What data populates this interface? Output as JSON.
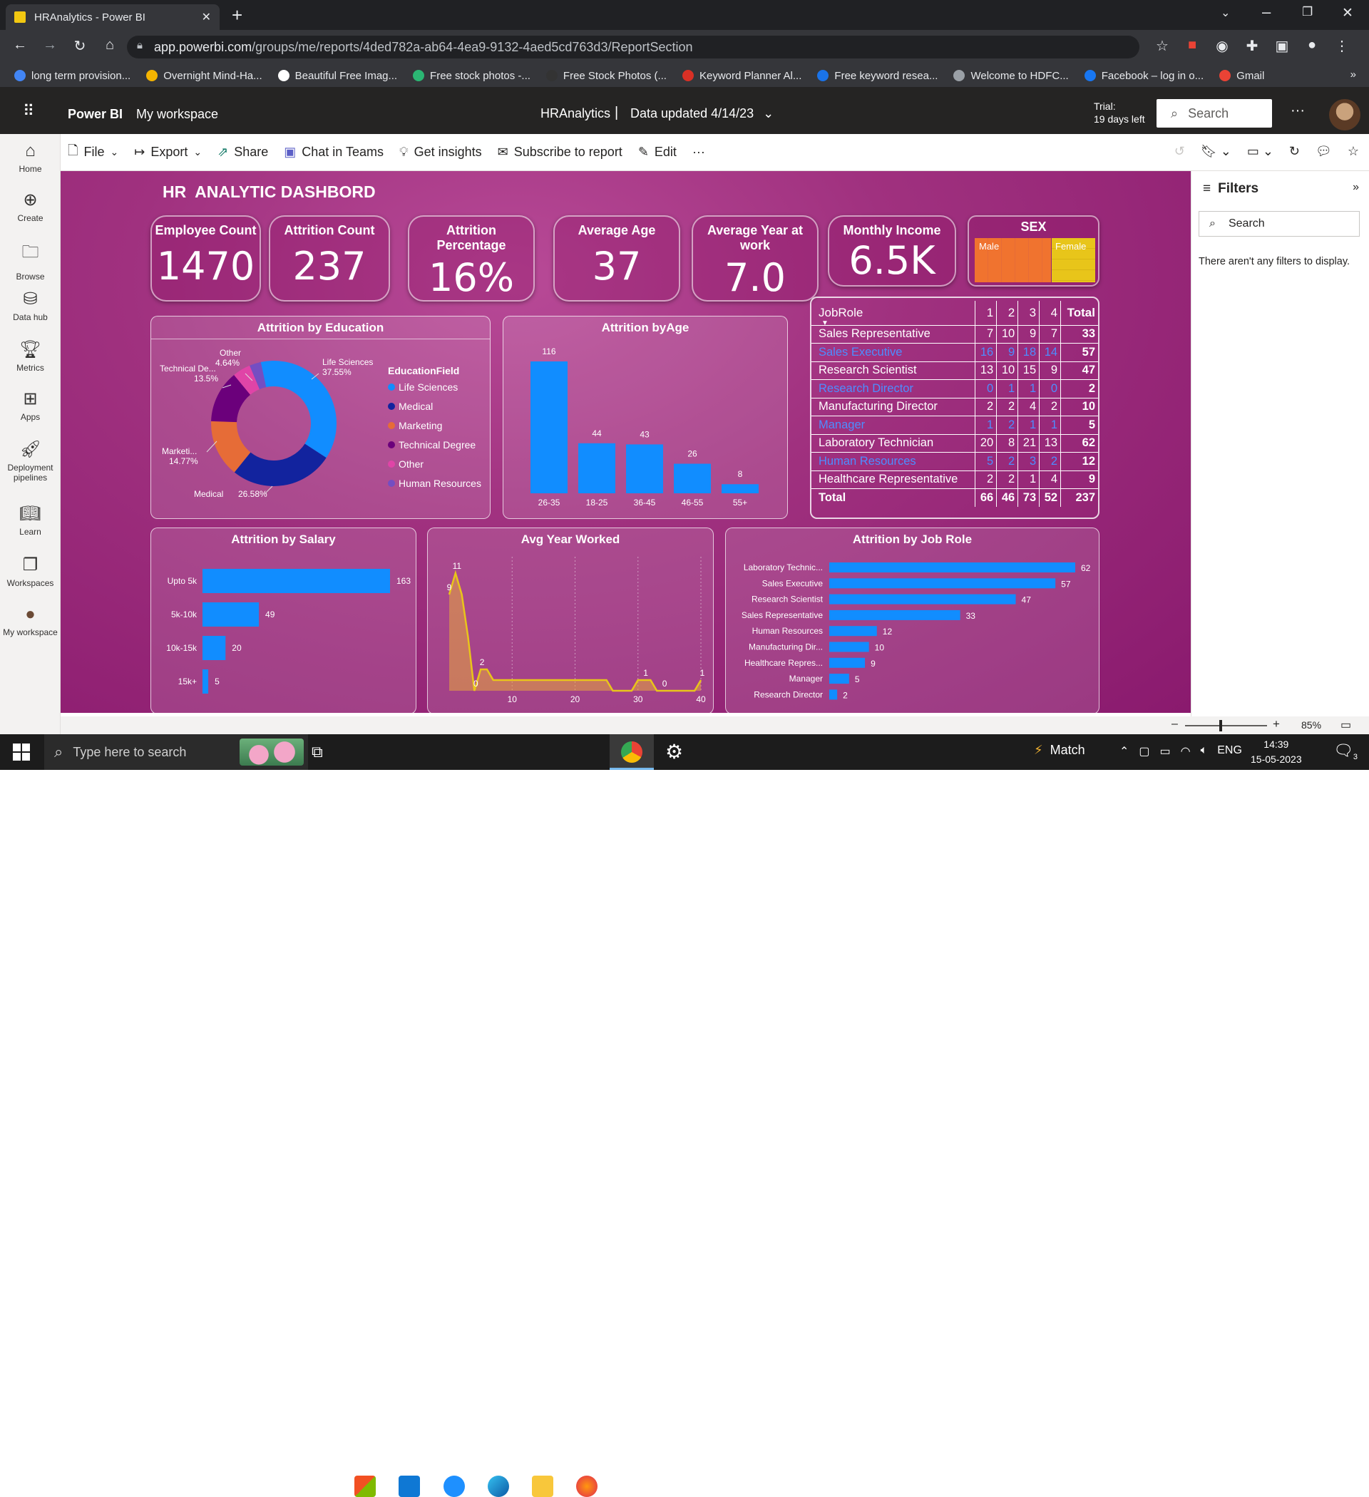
{
  "browser": {
    "tab_title": "HRAnalytics - Power BI",
    "url_host": "app.powerbi.com",
    "url_path": "/groups/me/reports/4ded782a-ab64-4ea9-9132-4aed5cd763d3/ReportSection",
    "bookmarks": [
      {
        "label": "long term provision...",
        "color": "#4285f4"
      },
      {
        "label": "Overnight Mind-Ha...",
        "color": "#f4b400"
      },
      {
        "label": "Beautiful Free Imag...",
        "color": "#ffffff"
      },
      {
        "label": "Free stock photos -...",
        "color": "#2bb673"
      },
      {
        "label": "Free Stock Photos (...",
        "color": "#333333"
      },
      {
        "label": "Keyword Planner Al...",
        "color": "#d93025"
      },
      {
        "label": "Free keyword resea...",
        "color": "#1a73e8"
      },
      {
        "label": "Welcome to HDFC...",
        "color": "#9aa0a6"
      },
      {
        "label": "Facebook – log in o...",
        "color": "#1877f2"
      },
      {
        "label": "Gmail",
        "color": "#ea4335"
      }
    ]
  },
  "pbi": {
    "app_name": "Power BI",
    "workspace": "My workspace",
    "report_name": "HRAnalytics",
    "data_updated": "Data updated 4/14/23",
    "trial_line1": "Trial:",
    "trial_line2": "19 days left",
    "search_placeholder": "Search",
    "commands": [
      "File",
      "Export",
      "Share",
      "Chat in Teams",
      "Get insights",
      "Subscribe to report",
      "Edit"
    ],
    "nav": [
      {
        "label": "Home",
        "icon": "home-icon"
      },
      {
        "label": "Create",
        "icon": "plus-circle-icon"
      },
      {
        "label": "Browse",
        "icon": "folder-icon"
      },
      {
        "label": "Data hub",
        "icon": "database-icon"
      },
      {
        "label": "Metrics",
        "icon": "trophy-icon"
      },
      {
        "label": "Apps",
        "icon": "apps-icon"
      },
      {
        "label": "Deployment pipelines",
        "icon": "rocket-icon"
      },
      {
        "label": "Learn",
        "icon": "book-icon"
      },
      {
        "label": "Workspaces",
        "icon": "workspaces-icon"
      },
      {
        "label": "My workspace",
        "icon": "avatar-icon"
      }
    ],
    "filters_title": "Filters",
    "filters_search": "Search",
    "filters_empty": "There aren't any filters to display.",
    "zoom": "85%"
  },
  "dashboard": {
    "title": "HR  ANALYTIC DASHBORD",
    "kpis": [
      {
        "label": "Employee Count",
        "value": "1470"
      },
      {
        "label": "Attrition Count",
        "value": "237"
      },
      {
        "label": "Attrition Percentage",
        "value": "16%"
      },
      {
        "label": "Average Age",
        "value": "37"
      },
      {
        "label": "Average Year at work",
        "value": "7.0"
      },
      {
        "label": "Monthly Income",
        "value": "6.5K"
      }
    ],
    "sex": {
      "title": "SEX",
      "male": "Male",
      "female": "Female"
    }
  },
  "chart_data": [
    {
      "type": "pie",
      "title": "Attrition by Education",
      "legend_title": "EducationField",
      "slices": [
        {
          "name": "Life Sciences",
          "value": 37.55,
          "label": "37.55%",
          "color": "#118dff"
        },
        {
          "name": "Medical",
          "value": 26.58,
          "label": "26.58%",
          "color": "#12239e"
        },
        {
          "name": "Marketing",
          "value": 14.77,
          "label": "14.77%",
          "color": "#e66c37"
        },
        {
          "name": "Technical Degree",
          "value": 13.5,
          "label": "13.5%",
          "color": "#6b007b"
        },
        {
          "name": "Other",
          "value": 4.64,
          "label": "4.64%",
          "color": "#e044a7"
        },
        {
          "name": "Human Resources",
          "value": 2.96,
          "label": "",
          "color": "#744ec2"
        }
      ],
      "slice_labels": [
        "Life Sciences",
        "Medical",
        "Marketi...",
        "Technical De...",
        "Other"
      ]
    },
    {
      "type": "bar",
      "title": "Attrition byAge",
      "categories": [
        "26-35",
        "18-25",
        "36-45",
        "46-55",
        "55+"
      ],
      "values": [
        116,
        44,
        43,
        26,
        8
      ],
      "color": "#118dff"
    },
    {
      "type": "table",
      "title": "JobRole",
      "columns": [
        "JobRole",
        "1",
        "2",
        "3",
        "4",
        "Total"
      ],
      "rows": [
        [
          "Sales Representative",
          "7",
          "10",
          "9",
          "7",
          "33"
        ],
        [
          "Sales Executive",
          "16",
          "9",
          "18",
          "14",
          "57"
        ],
        [
          "Research Scientist",
          "13",
          "10",
          "15",
          "9",
          "47"
        ],
        [
          "Research Director",
          "0",
          "1",
          "1",
          "0",
          "2"
        ],
        [
          "Manufacturing Director",
          "2",
          "2",
          "4",
          "2",
          "10"
        ],
        [
          "Manager",
          "1",
          "2",
          "1",
          "1",
          "5"
        ],
        [
          "Laboratory Technician",
          "20",
          "8",
          "21",
          "13",
          "62"
        ],
        [
          "Human Resources",
          "5",
          "2",
          "3",
          "2",
          "12"
        ],
        [
          "Healthcare Representative",
          "2",
          "2",
          "1",
          "4",
          "9"
        ]
      ],
      "total": [
        "Total",
        "66",
        "46",
        "73",
        "52",
        "237"
      ]
    },
    {
      "type": "bar",
      "orientation": "horizontal",
      "title": "Attrition by Salary",
      "categories": [
        "Upto 5k",
        "5k-10k",
        "10k-15k",
        "15k+"
      ],
      "values": [
        163,
        49,
        20,
        5
      ],
      "color": "#118dff"
    },
    {
      "type": "area",
      "title": "Avg Year Worked",
      "x": [
        0,
        1,
        2,
        3,
        4,
        5,
        6,
        7,
        8,
        9,
        10,
        11,
        12,
        13,
        14,
        15,
        16,
        17,
        18,
        19,
        20,
        21,
        22,
        23,
        24,
        25,
        26,
        27,
        28,
        29,
        30,
        31,
        32,
        33,
        34,
        35,
        36,
        37,
        38,
        39,
        40
      ],
      "y": [
        9,
        11,
        9,
        5,
        0,
        2,
        2,
        1,
        1,
        1,
        1,
        1,
        1,
        1,
        1,
        1,
        1,
        1,
        1,
        1,
        1,
        1,
        1,
        1,
        1,
        1,
        0,
        0,
        0,
        0,
        1,
        1,
        1,
        0,
        0,
        0,
        0,
        0,
        0,
        0,
        1
      ],
      "labels": [
        {
          "x": 1,
          "text": "11"
        },
        {
          "x": 0,
          "text": "9"
        },
        {
          "x": 5,
          "text": "2"
        },
        {
          "x": 4,
          "text": "0"
        },
        {
          "x": 31,
          "text": "1"
        },
        {
          "x": 34,
          "text": "0"
        },
        {
          "x": 40,
          "text": "1"
        }
      ],
      "xticks": [
        10,
        20,
        30,
        40
      ],
      "xlim": [
        0,
        40
      ],
      "ylim": [
        0,
        12
      ]
    },
    {
      "type": "bar",
      "orientation": "horizontal",
      "title": "Attrition by Job Role",
      "categories": [
        "Laboratory Technic...",
        "Sales Executive",
        "Research Scientist",
        "Sales Representative",
        "Human Resources",
        "Manufacturing Dir...",
        "Healthcare Repres...",
        "Manager",
        "Research Director"
      ],
      "values": [
        62,
        57,
        47,
        33,
        12,
        10,
        9,
        5,
        2
      ],
      "color": "#118dff"
    }
  ],
  "taskbar": {
    "search_placeholder": "Type here to search",
    "weather": "Match",
    "lang": "ENG",
    "time": "14:39",
    "date": "15-05-2023",
    "notif": "3"
  }
}
